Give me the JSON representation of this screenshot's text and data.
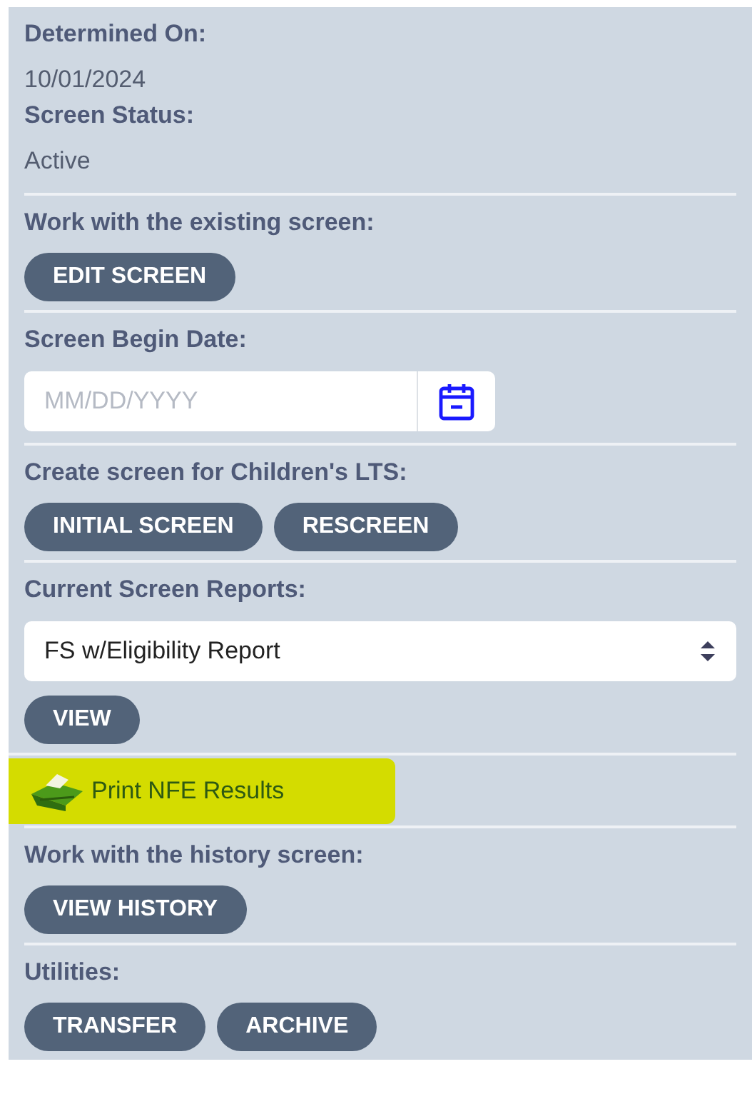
{
  "panel": {
    "sections": [
      {
        "kind": "fields",
        "fields": [
          {
            "label": "Determined On:",
            "value": "10/01/2024"
          },
          {
            "label": "Screen Status:",
            "value": "Active"
          }
        ]
      },
      {
        "kind": "buttons",
        "label": "Work with the existing screen:",
        "buttons": [
          "EDIT SCREEN"
        ]
      },
      {
        "kind": "date",
        "label": "Screen Begin Date:",
        "placeholder": "MM/DD/YYYY"
      },
      {
        "kind": "buttons",
        "label": "Create screen for Children's LTS:",
        "buttons": [
          "INITIAL SCREEN",
          "RESCREEN"
        ]
      },
      {
        "kind": "select",
        "label": "Current Screen Reports:",
        "value": "FS w/Eligibility Report",
        "buttons": [
          "VIEW"
        ]
      },
      {
        "kind": "link",
        "text": "Print NFE Results",
        "highlighted": true
      },
      {
        "kind": "buttons",
        "label": "Work with the history screen:",
        "buttons": [
          "VIEW HISTORY"
        ]
      },
      {
        "kind": "buttons",
        "label": "Utilities:",
        "buttons": [
          "TRANSFER",
          "ARCHIVE"
        ]
      }
    ]
  }
}
